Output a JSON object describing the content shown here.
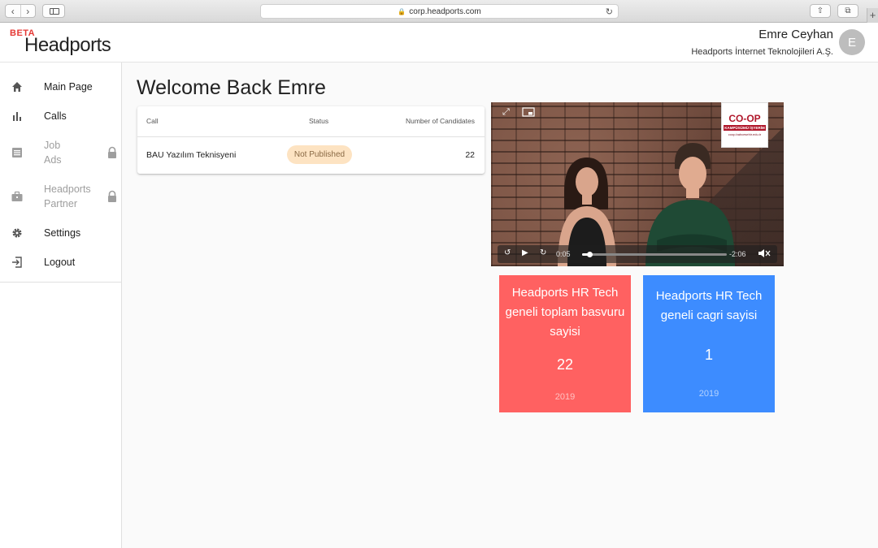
{
  "browser": {
    "url": "corp.headports.com"
  },
  "header": {
    "logo_beta": "BETA",
    "logo_text": "Headports",
    "user_name": "Emre Ceyhan",
    "company": "Headports İnternet Teknolojileri A.Ş.",
    "avatar_initial": "E"
  },
  "sidebar": {
    "items": [
      {
        "label": "Main Page",
        "icon": "home-icon",
        "locked": false
      },
      {
        "label": "Calls",
        "icon": "bar-chart-icon",
        "locked": false
      },
      {
        "label": "Job Ads",
        "icon": "list-icon",
        "locked": true
      },
      {
        "label": "Headports Partner",
        "icon": "briefcase-icon",
        "locked": true
      },
      {
        "label": "Settings",
        "icon": "gear-icon",
        "locked": false
      },
      {
        "label": "Logout",
        "icon": "logout-icon",
        "locked": false
      }
    ]
  },
  "main": {
    "welcome": "Welcome Back Emre",
    "table": {
      "headers": [
        "Call",
        "Status",
        "Number of Candidates"
      ],
      "rows": [
        {
          "call": "BAU Yazılım Teknisyeni",
          "status": "Not Published",
          "candidates": "22"
        }
      ]
    },
    "video": {
      "elapsed": "0:05",
      "remaining": "-2:06",
      "progress_fraction": 0.05,
      "badge_title": "CO-OP",
      "badge_sub": "KAMPÜSÜMÜ İŞYERİM",
      "badge_url": "coop.bahcesehir.edu.tr"
    },
    "stats": [
      {
        "title": "Headports HR Tech geneli toplam basvuru sayisi",
        "value": "22",
        "year": "2019",
        "color": "#ff6161"
      },
      {
        "title": "Headports HR Tech geneli cagri sayisi",
        "value": "1",
        "year": "2019",
        "color": "#3d8cff"
      }
    ]
  }
}
